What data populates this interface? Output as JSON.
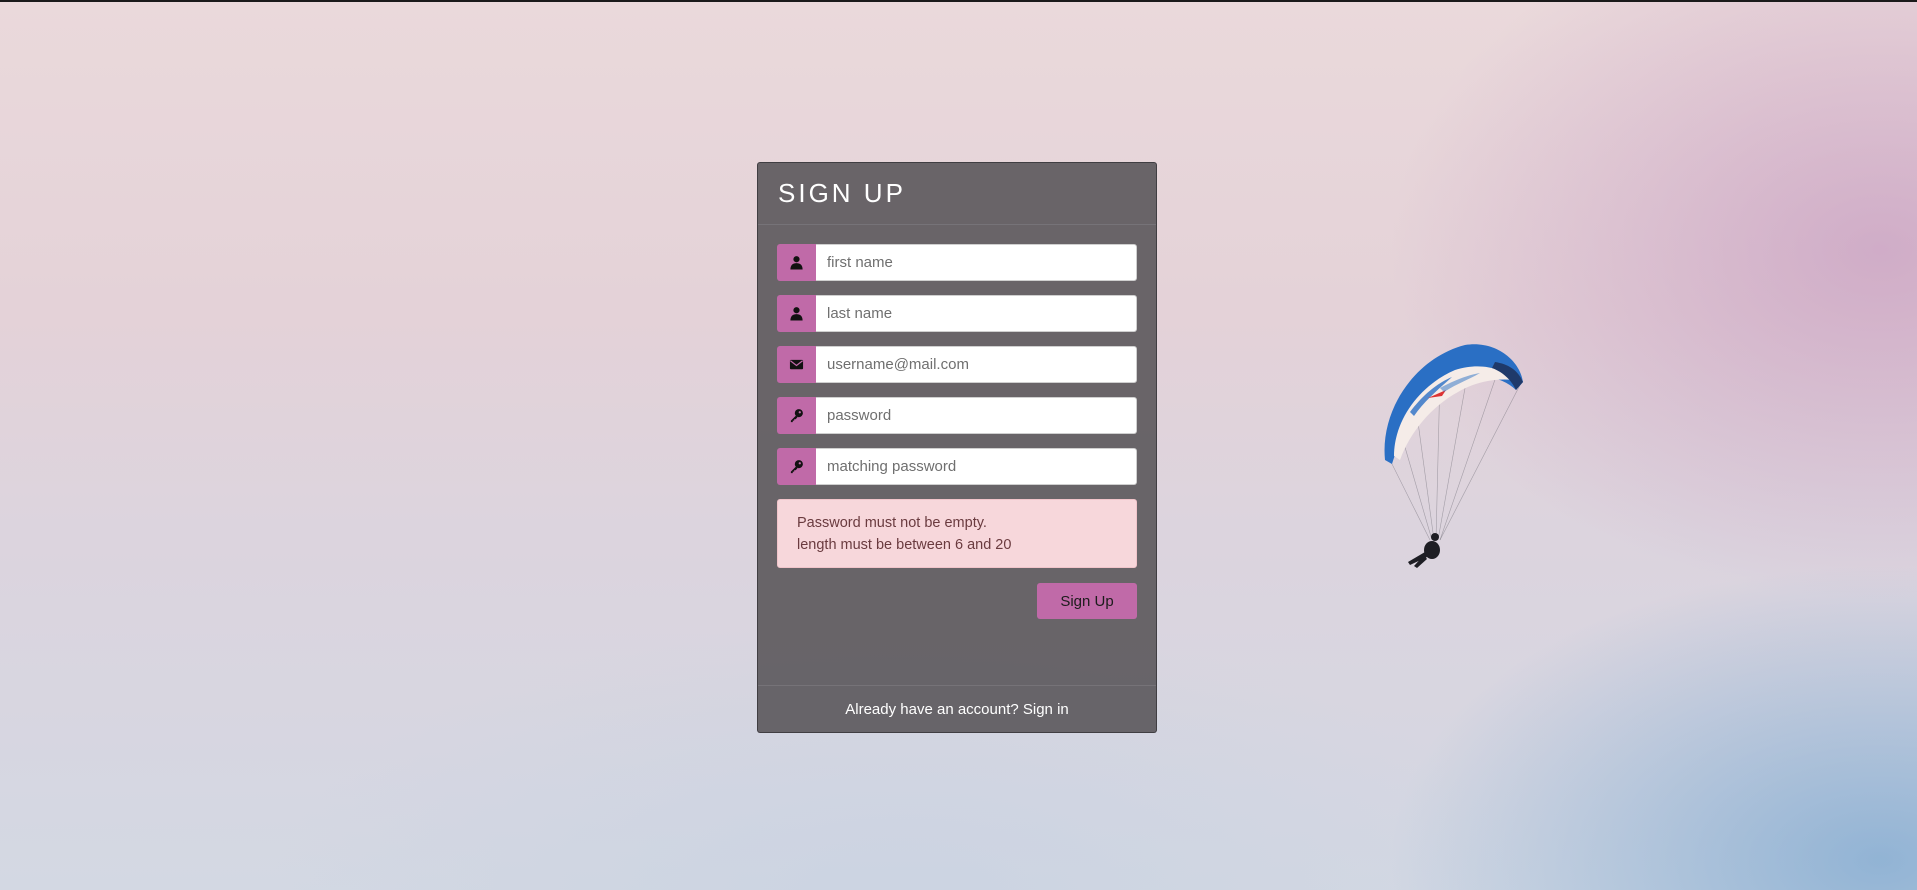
{
  "signup": {
    "title": "SIGN UP",
    "fields": [
      {
        "name": "first-name",
        "icon": "user-icon",
        "placeholder": "first name",
        "value": ""
      },
      {
        "name": "last-name",
        "icon": "user-icon",
        "placeholder": "last name",
        "value": ""
      },
      {
        "name": "email",
        "icon": "envelope-icon",
        "placeholder": "username@mail.com",
        "value": ""
      },
      {
        "name": "password",
        "icon": "key-icon",
        "placeholder": "password",
        "value": ""
      },
      {
        "name": "matching-password",
        "icon": "key-icon",
        "placeholder": "matching password",
        "value": ""
      }
    ],
    "error": {
      "line1": "Password must not be empty.",
      "line2": "length must be between 6 and 20"
    },
    "submit_label": "Sign Up",
    "footer": {
      "prompt": "Already have an account?",
      "link": "Sign in"
    }
  },
  "colors": {
    "accent": "#c06aa8",
    "card_bg": "#585458",
    "alert_bg": "#f7d7db",
    "alert_text": "#6a3b3f"
  }
}
